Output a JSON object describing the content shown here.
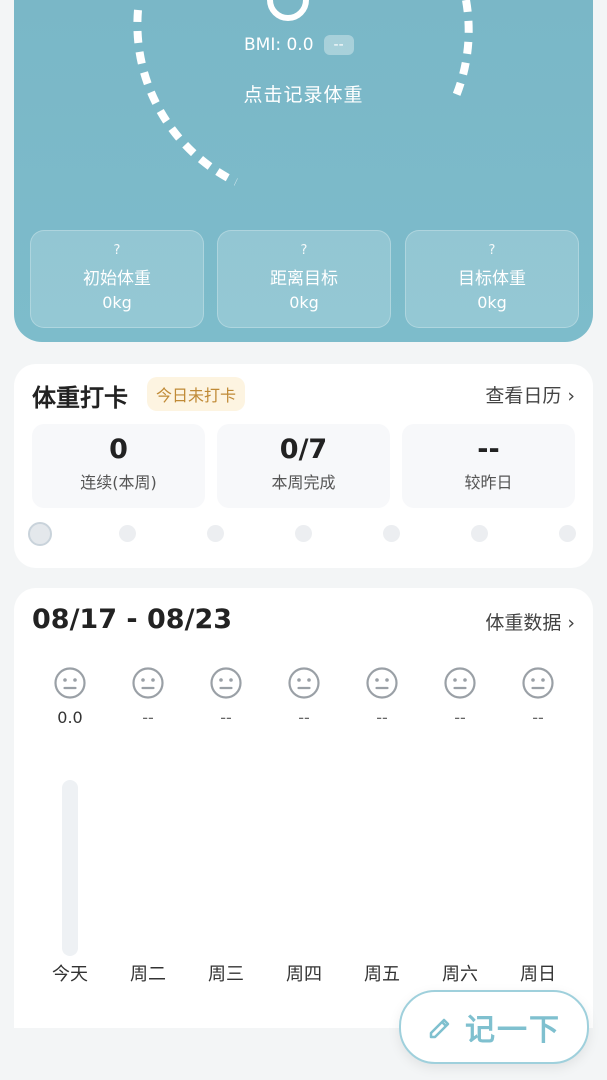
{
  "hero": {
    "bmi_label": "BMI: 0.0",
    "bmi_badge": "--",
    "record_hint": "点击记录体重",
    "stats": [
      {
        "q": "?",
        "label": "初始体重",
        "value": "0kg"
      },
      {
        "q": "?",
        "label": "距离目标",
        "value": "0kg"
      },
      {
        "q": "?",
        "label": "目标体重",
        "value": "0kg"
      }
    ]
  },
  "checkin": {
    "title": "体重打卡",
    "tag": "今日未打卡",
    "calendar_link": "查看日历 ›",
    "stats": [
      {
        "num": "0",
        "cap": "连续(本周)"
      },
      {
        "num": "0/7",
        "cap": "本周完成"
      },
      {
        "num": "--",
        "cap": "较昨日"
      }
    ]
  },
  "weekly": {
    "range": "08/17 - 08/23",
    "data_link": "体重数据 ›",
    "days": [
      {
        "label": "今天",
        "value": "0.0"
      },
      {
        "label": "周二",
        "value": "--"
      },
      {
        "label": "周三",
        "value": "--"
      },
      {
        "label": "周四",
        "value": "--"
      },
      {
        "label": "周五",
        "value": "--"
      },
      {
        "label": "周六",
        "value": "--"
      },
      {
        "label": "周日",
        "value": "--"
      }
    ]
  },
  "fab": {
    "label": "记一下",
    "icon": "pencil-icon"
  },
  "colors": {
    "hero_bg": "#7ab7c7",
    "tag_text": "#c08a36",
    "fab_text": "#7fc0cf"
  }
}
